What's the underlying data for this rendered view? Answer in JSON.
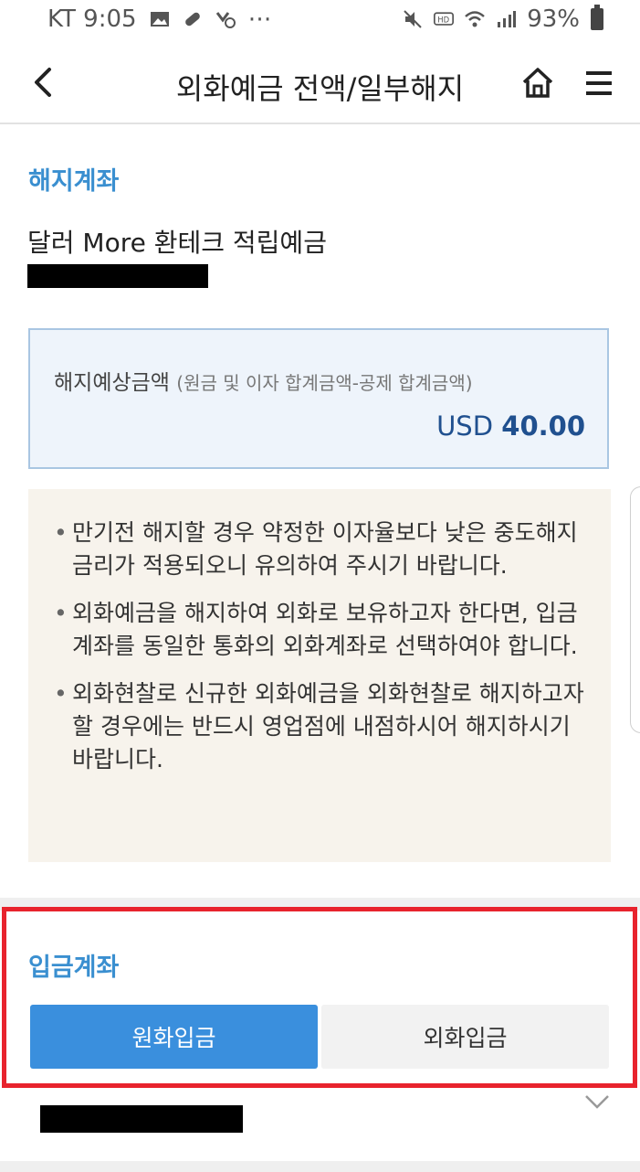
{
  "status_bar": {
    "carrier_time": "KT 9:05",
    "extra": "⋯",
    "battery": "93%"
  },
  "header": {
    "title": "외화예금 전액/일부해지"
  },
  "close_account": {
    "section_title": "해지계좌",
    "product_name": "달러 More 환테크 적립예금",
    "expected_amount_label": "해지예상금액",
    "expected_amount_note": "(원금 및 이자 합계금액-공제 합계금액)",
    "currency": "USD",
    "amount": "40.00"
  },
  "notices": [
    "만기전 해지할 경우 약정한 이자율보다 낮은 중도해지 금리가 적용되오니 유의하여 주시기 바랍니다.",
    "외화예금을 해지하여 외화로 보유하고자 한다면, 입금계좌를 동일한 통화의 외화계좌로 선택하여야 합니다.",
    "외화현찰로 신규한 외화예금을 외화현찰로 해지하고자 할 경우에는 반드시 영업점에 내점하시어 해지하시기 바랍니다."
  ],
  "deposit_account": {
    "section_title": "입금계좌",
    "won_button": "원화입금",
    "fx_button": "외화입금"
  },
  "colors": {
    "accent_blue": "#3a8fdd",
    "highlight_red": "#e8232d",
    "notice_bg": "#f7f3ec",
    "amount_box_bg": "#eef4fb"
  }
}
